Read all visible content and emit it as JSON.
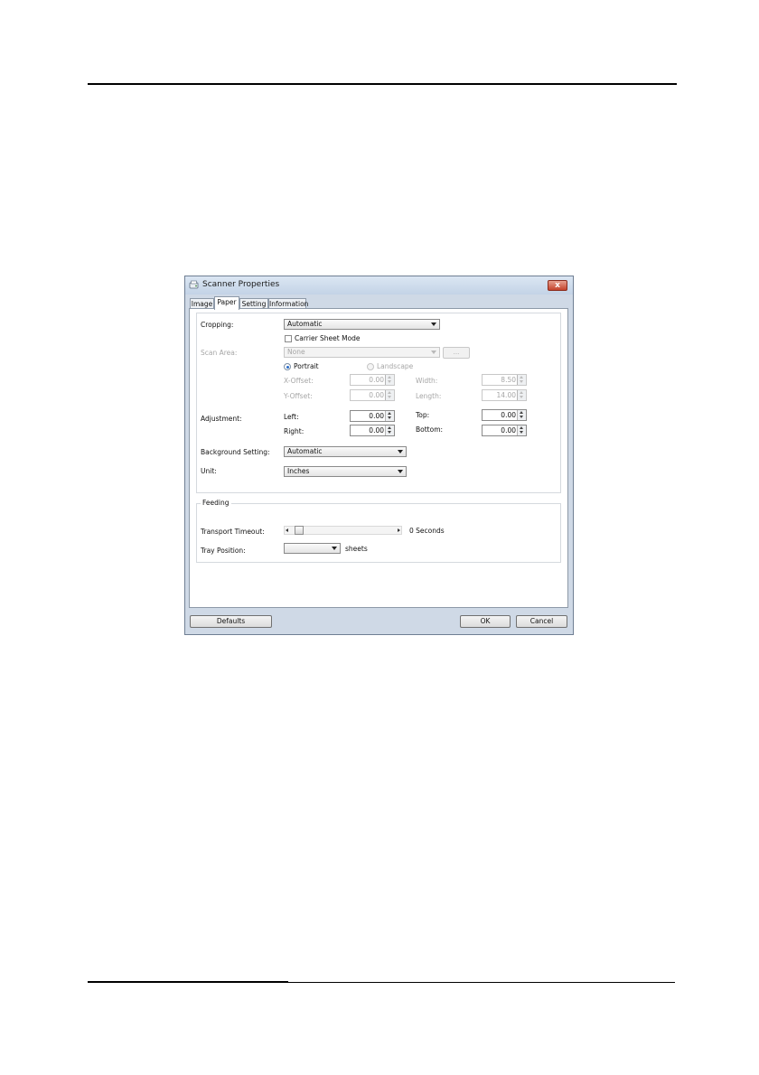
{
  "window": {
    "title": "Scanner Properties",
    "close_label": "x"
  },
  "tabs": [
    {
      "label": "Image",
      "active": false
    },
    {
      "label": "Paper",
      "active": true
    },
    {
      "label": "Setting",
      "active": false
    },
    {
      "label": "Information",
      "active": false
    }
  ],
  "paper": {
    "cropping_label": "Cropping:",
    "cropping_value": "Automatic",
    "carrier_sheet_label": "Carrier Sheet Mode",
    "carrier_sheet_checked": false,
    "scan_area_label": "Scan Area:",
    "scan_area_value": "None",
    "scan_area_button": "...",
    "portrait_label": "Portrait",
    "portrait_selected": true,
    "landscape_label": "Landscape",
    "x_offset_label": "X-Offset:",
    "x_offset_value": "0.00",
    "y_offset_label": "Y-Offset:",
    "y_offset_value": "0.00",
    "width_label": "Width:",
    "width_value": "8.50",
    "length_label": "Length:",
    "length_value": "14.00",
    "adjustment_label": "Adjustment:",
    "left_label": "Left:",
    "left_value": "0.00",
    "right_label": "Right:",
    "right_value": "0.00",
    "top_label": "Top:",
    "top_value": "0.00",
    "bottom_label": "Bottom:",
    "bottom_value": "0.00",
    "background_label": "Background Setting:",
    "background_value": "Automatic",
    "unit_label": "Unit:",
    "unit_value": "Inches"
  },
  "feeding": {
    "group_label": "Feeding",
    "transport_timeout_label": "Transport Timeout:",
    "transport_timeout_value": "0 Seconds",
    "transport_timeout_level": 0,
    "tray_position_label": "Tray Position:",
    "tray_position_value": "",
    "tray_position_unit": "sheets"
  },
  "buttons": {
    "defaults": "Defaults",
    "ok": "OK",
    "cancel": "Cancel"
  },
  "colors": {
    "window_frame": "#cfd9e6",
    "close_button": "#c4432c",
    "radio_selected": "#2a6cc8"
  }
}
